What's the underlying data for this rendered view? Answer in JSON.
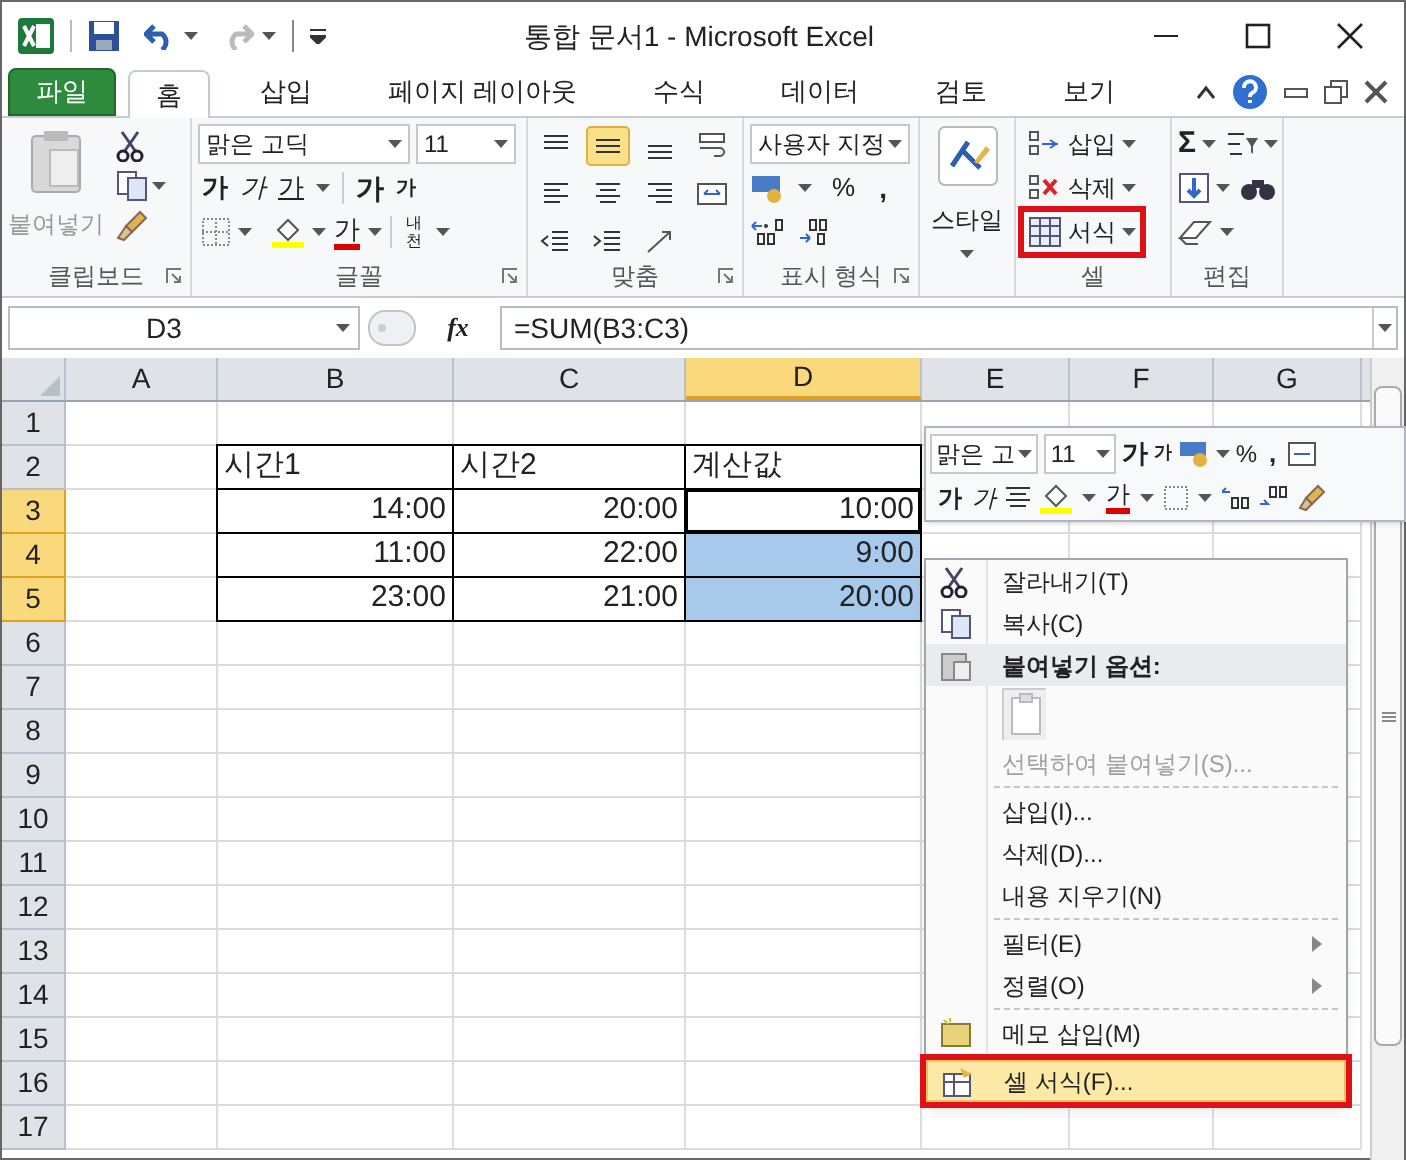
{
  "title_bar": {
    "title": "통합 문서1  -  Microsoft Excel"
  },
  "tabs": [
    {
      "label": "파일",
      "kind": "file",
      "selected": false
    },
    {
      "label": "홈",
      "kind": "tab",
      "selected": true
    },
    {
      "label": "삽입",
      "kind": "tab",
      "selected": false
    },
    {
      "label": "페이지 레이아웃",
      "kind": "tab",
      "selected": false
    },
    {
      "label": "수식",
      "kind": "tab",
      "selected": false
    },
    {
      "label": "데이터",
      "kind": "tab",
      "selected": false
    },
    {
      "label": "검토",
      "kind": "tab",
      "selected": false
    },
    {
      "label": "보기",
      "kind": "tab",
      "selected": false
    }
  ],
  "ribbon": {
    "clipboard": {
      "label": "클립보드",
      "paste": "붙여넣기"
    },
    "font": {
      "label": "글꼴",
      "font_name": "맑은 고딕",
      "font_size": "11",
      "style_buttons": [
        {
          "label": "가",
          "kind": "bold"
        },
        {
          "label": "가",
          "kind": "italic"
        },
        {
          "label": "가",
          "kind": "underline"
        }
      ],
      "size_buttons": [
        {
          "label": "가",
          "kind": "grow"
        },
        {
          "label": "가",
          "kind": "shrink"
        }
      ],
      "font_color": "가",
      "phonetic": "내천"
    },
    "alignment": {
      "label": "맞춤",
      "buttons": [
        {
          "kind": "top",
          "selected": false
        },
        {
          "kind": "middle",
          "selected": true
        },
        {
          "kind": "bottom",
          "selected": false
        },
        {
          "kind": "wrap",
          "selected": false
        },
        {
          "kind": "left",
          "selected": false
        },
        {
          "kind": "center",
          "selected": false
        },
        {
          "kind": "right",
          "selected": false
        },
        {
          "kind": "merge",
          "selected": false
        },
        {
          "kind": "outdent",
          "selected": false
        },
        {
          "kind": "indent",
          "selected": false
        },
        {
          "kind": "orient",
          "selected": false
        }
      ]
    },
    "number": {
      "label": "표시 형식",
      "format": "사용자 지정",
      "percent": "%",
      "comma": ","
    },
    "styles": {
      "label": "스타일"
    },
    "cells": {
      "label": "셀",
      "buttons": [
        {
          "label": "삽입",
          "annotated": false
        },
        {
          "label": "삭제",
          "annotated": false
        },
        {
          "label": "서식",
          "annotated": true
        }
      ]
    },
    "editing": {
      "label": "편집",
      "sum": "Σ"
    }
  },
  "formula_bar": {
    "name_box": "D3",
    "fx": "fx",
    "formula": "=SUM(B3:C3)"
  },
  "sheet": {
    "columns": [
      {
        "label": "A",
        "selected": false
      },
      {
        "label": "B",
        "selected": false
      },
      {
        "label": "C",
        "selected": false
      },
      {
        "label": "D",
        "selected": true
      },
      {
        "label": "E",
        "selected": false
      },
      {
        "label": "F",
        "selected": false
      },
      {
        "label": "G",
        "selected": false
      }
    ],
    "rows": [
      {
        "header": "1",
        "selected": false,
        "cells": []
      },
      {
        "header": "2",
        "selected": false,
        "cells": [
          {},
          {
            "value": "시간1",
            "kind": "text",
            "bordered": true
          },
          {
            "value": "시간2",
            "kind": "text",
            "bordered": true
          },
          {
            "value": "계산값",
            "kind": "text",
            "bordered": true
          }
        ]
      },
      {
        "header": "3",
        "selected": true,
        "cells": [
          {},
          {
            "value": "14:00",
            "kind": "time",
            "bordered": true
          },
          {
            "value": "20:00",
            "kind": "time",
            "bordered": true
          },
          {
            "value": "10:00",
            "kind": "time",
            "bordered": true,
            "active": true
          }
        ]
      },
      {
        "header": "4",
        "selected": true,
        "cells": [
          {},
          {
            "value": "11:00",
            "kind": "time",
            "bordered": true
          },
          {
            "value": "22:00",
            "kind": "time",
            "bordered": true
          },
          {
            "value": "9:00",
            "kind": "time",
            "bordered": true,
            "selected": true,
            "active": false
          }
        ]
      },
      {
        "header": "5",
        "selected": true,
        "cells": [
          {},
          {
            "value": "23:00",
            "kind": "time",
            "bordered": true
          },
          {
            "value": "21:00",
            "kind": "time",
            "bordered": true
          },
          {
            "value": "20:00",
            "kind": "time",
            "bordered": true,
            "selected": true,
            "active": false
          }
        ]
      },
      {
        "header": "6",
        "selected": false,
        "cells": []
      },
      {
        "header": "7",
        "selected": false,
        "cells": []
      },
      {
        "header": "8",
        "selected": false,
        "cells": []
      },
      {
        "header": "9",
        "selected": false,
        "cells": []
      },
      {
        "header": "10",
        "selected": false,
        "cells": []
      },
      {
        "header": "11",
        "selected": false,
        "cells": []
      },
      {
        "header": "12",
        "selected": false,
        "cells": []
      },
      {
        "header": "13",
        "selected": false,
        "cells": []
      },
      {
        "header": "14",
        "selected": false,
        "cells": []
      },
      {
        "header": "15",
        "selected": false,
        "cells": []
      },
      {
        "header": "16",
        "selected": false,
        "cells": []
      },
      {
        "header": "17",
        "selected": false,
        "cells": []
      }
    ]
  },
  "mini_toolbar": {
    "font_name": "맑은 고",
    "font_size": "11",
    "grow": "가",
    "shrink": "가",
    "percent": "%",
    "comma": ",",
    "bold": "가",
    "italic": "가",
    "font_color": "가"
  },
  "context_menu": [
    {
      "kind": "command",
      "label": "잘라내기(T)",
      "disabled": false,
      "submenu": false,
      "selected": false,
      "annotated": false
    },
    {
      "kind": "command",
      "label": "복사(C)",
      "disabled": false,
      "submenu": false,
      "selected": false,
      "annotated": false
    },
    {
      "kind": "header",
      "label": "붙여넣기 옵션:"
    },
    {
      "kind": "paste_options"
    },
    {
      "kind": "command",
      "label": "선택하여 붙여넣기(S)...",
      "disabled": true,
      "submenu": false,
      "selected": false,
      "annotated": false
    },
    {
      "kind": "separator"
    },
    {
      "kind": "command",
      "label": "삽입(I)...",
      "disabled": false,
      "submenu": false,
      "selected": false,
      "annotated": false
    },
    {
      "kind": "command",
      "label": "삭제(D)...",
      "disabled": false,
      "submenu": false,
      "selected": false,
      "annotated": false
    },
    {
      "kind": "command",
      "label": "내용 지우기(N)",
      "disabled": false,
      "submenu": false,
      "selected": false,
      "annotated": false
    },
    {
      "kind": "separator"
    },
    {
      "kind": "command",
      "label": "필터(E)",
      "disabled": false,
      "submenu": true,
      "selected": false,
      "annotated": false
    },
    {
      "kind": "command",
      "label": "정렬(O)",
      "disabled": false,
      "submenu": true,
      "selected": false,
      "annotated": false
    },
    {
      "kind": "separator"
    },
    {
      "kind": "command",
      "label": "메모 삽입(M)",
      "disabled": false,
      "submenu": false,
      "selected": false,
      "annotated": false
    },
    {
      "kind": "separator"
    },
    {
      "kind": "command",
      "label": "셀 서식(F)...",
      "disabled": false,
      "submenu": false,
      "selected": true,
      "annotated": true
    }
  ]
}
